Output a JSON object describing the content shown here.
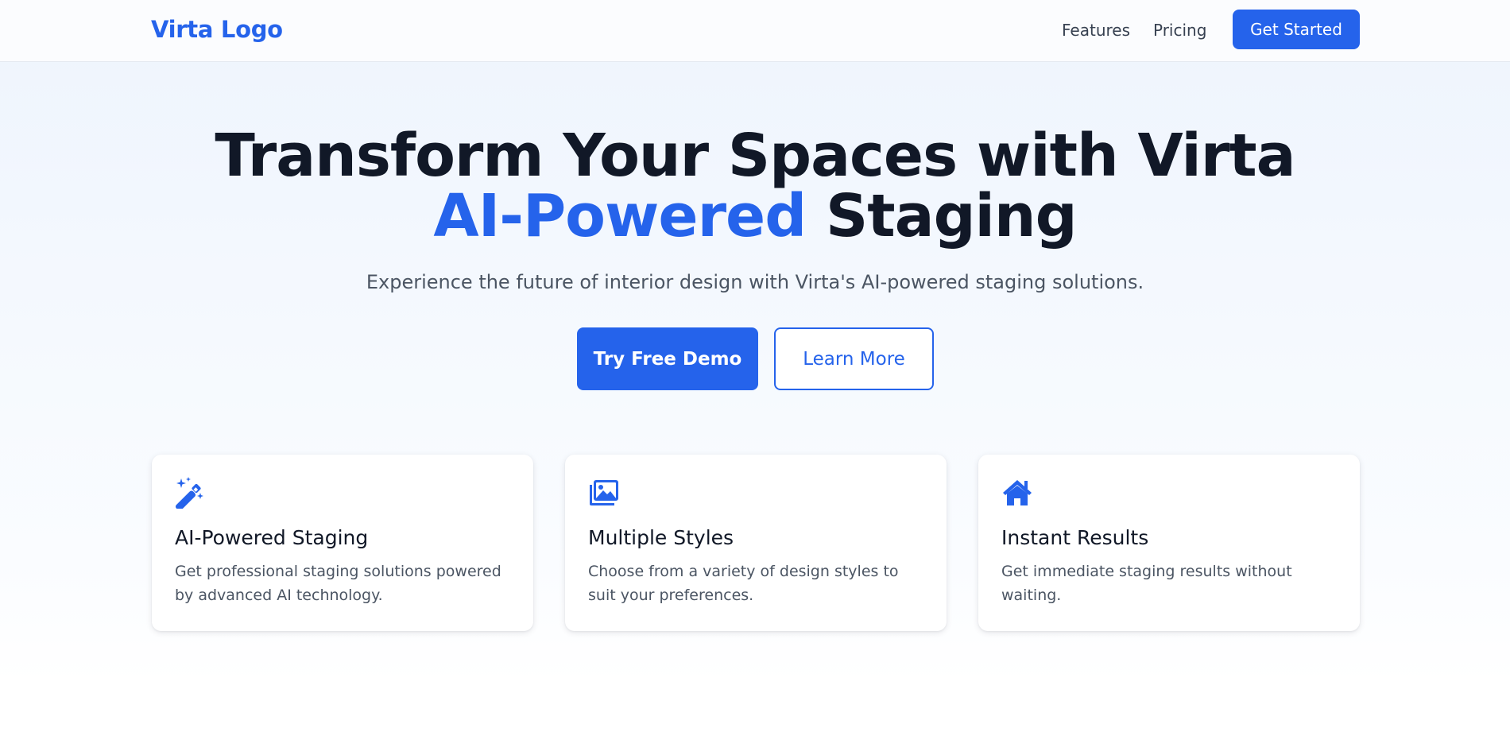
{
  "nav": {
    "logo": "Virta Logo",
    "links": [
      "Features",
      "Pricing"
    ],
    "cta": "Get Started"
  },
  "hero": {
    "title_part1": "Transform Your Spaces with Virta ",
    "title_accent": "AI-Powered",
    "title_part2": " Staging",
    "subtitle": "Experience the future of interior design with Virta's AI-powered staging solutions.",
    "primary_button": "Try Free Demo",
    "secondary_button": "Learn More"
  },
  "features": [
    {
      "icon": "magic-wand-icon",
      "title": "AI-Powered Staging",
      "description": "Get professional staging solutions powered by advanced AI technology."
    },
    {
      "icon": "images-icon",
      "title": "Multiple Styles",
      "description": "Choose from a variety of design styles to suit your preferences."
    },
    {
      "icon": "home-icon",
      "title": "Instant Results",
      "description": "Get immediate staging results without waiting."
    }
  ],
  "colors": {
    "accent": "#2563eb",
    "heading": "#111827",
    "body_text": "#4b5563"
  }
}
